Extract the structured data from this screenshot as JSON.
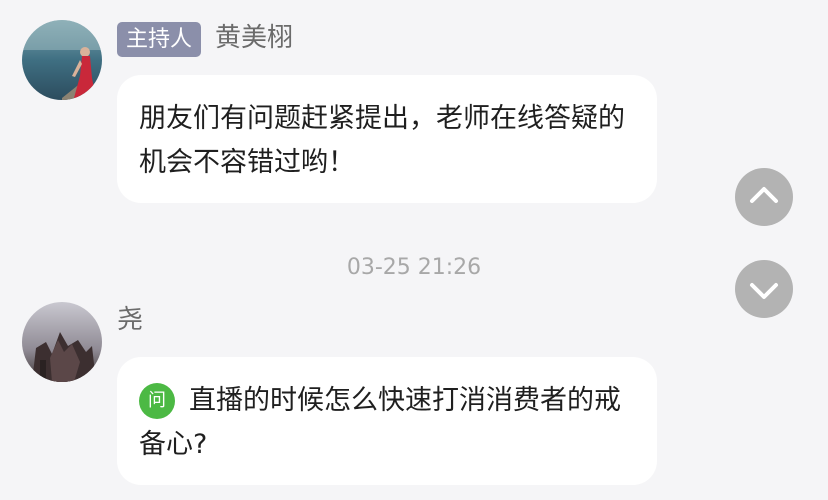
{
  "messages": [
    {
      "role_badge": "主持人",
      "sender": "黄美栩",
      "text": "朋友们有问题赶紧提出，老师在线答疑的机会不容错过哟！"
    },
    {
      "sender": "尧",
      "question_badge": "问",
      "text": "直播的时候怎么快速打消消费者的戒备心?"
    }
  ],
  "timestamp": "03-25 21:26",
  "scroll_controls": {
    "up_icon": "chevron-up-icon",
    "down_icon": "chevron-down-icon"
  },
  "colors": {
    "background": "#f5f5f7",
    "bubble": "#ffffff",
    "host_badge": "#8b8faa",
    "question_badge": "#4cb944",
    "scroll_button": "#b3b3b3"
  }
}
